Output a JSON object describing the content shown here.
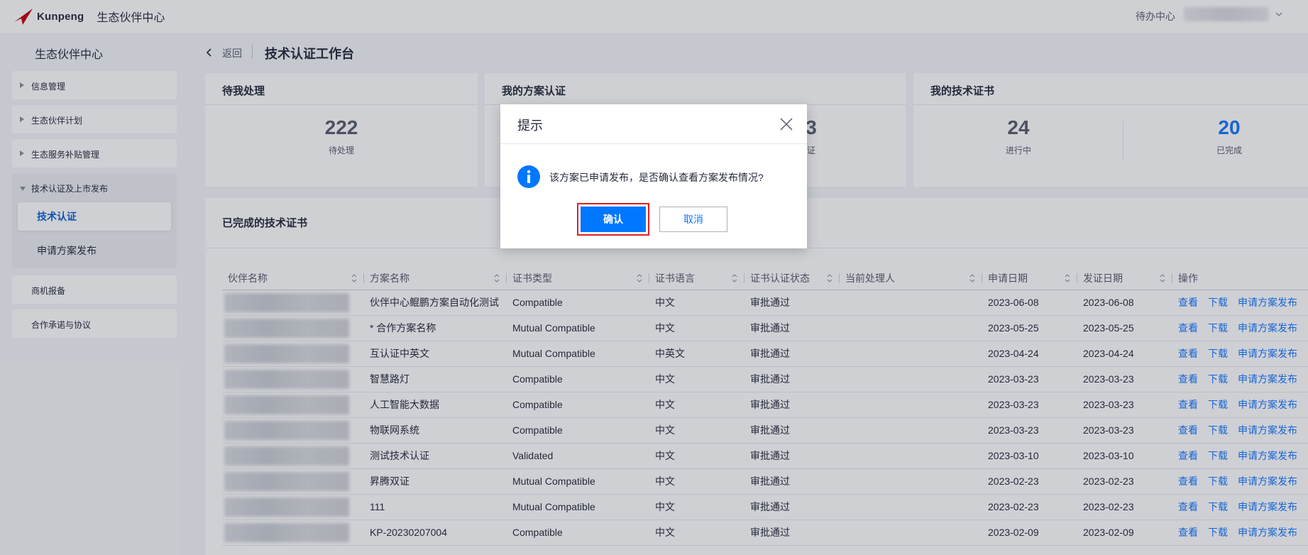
{
  "topbar": {
    "brand": "Kunpeng",
    "app_title": "生态伙伴中心",
    "todo": "待办中心"
  },
  "sidebar": {
    "title": "生态伙伴中心",
    "groups": [
      {
        "label": "信息管理"
      },
      {
        "label": "生态伙伴计划"
      },
      {
        "label": "生态服务补贴管理"
      },
      {
        "label": "技术认证及上市发布",
        "children": [
          {
            "label": "技术认证",
            "active": true
          },
          {
            "label": "申请方案发布"
          }
        ]
      },
      {
        "label": "商机报备"
      },
      {
        "label": "合作承诺与协议"
      }
    ]
  },
  "header": {
    "back": "返回",
    "title": "技术认证工作台"
  },
  "cards": {
    "pending": {
      "title": "待我处理",
      "value": "222",
      "label": "待处理"
    },
    "solution": {
      "title": "我的方案认证",
      "value_partial": "3",
      "label_partial": "证"
    },
    "certs": {
      "title": "我的技术证书",
      "in_progress_value": "24",
      "in_progress_label": "进行中",
      "done_value": "20",
      "done_label": "已完成"
    }
  },
  "table": {
    "title": "已完成的技术证书",
    "headers": [
      "伙伴名称",
      "方案名称",
      "证书类型",
      "证书语言",
      "证书认证状态",
      "当前处理人",
      "申请日期",
      "发证日期",
      "操作"
    ],
    "actions": {
      "view": "查看",
      "download": "下载",
      "publish": "申请方案发布"
    },
    "rows": [
      {
        "solution": "伙伴中心鲲鹏方案自动化测试",
        "type": "Compatible",
        "lang": "中文",
        "status": "审批通过",
        "handler": "",
        "apply": "2023-06-08",
        "issue": "2023-06-08"
      },
      {
        "solution": "* 合作方案名称",
        "type": "Mutual Compatible",
        "lang": "中文",
        "status": "审批通过",
        "handler": "",
        "apply": "2023-05-25",
        "issue": "2023-05-25"
      },
      {
        "solution": "互认证中英文",
        "type": "Mutual Compatible",
        "lang": "中英文",
        "status": "审批通过",
        "handler": "",
        "apply": "2023-04-24",
        "issue": "2023-04-24"
      },
      {
        "solution": "智慧路灯",
        "type": "Compatible",
        "lang": "中文",
        "status": "审批通过",
        "handler": "",
        "apply": "2023-03-23",
        "issue": "2023-03-23"
      },
      {
        "solution": "人工智能大数据",
        "type": "Compatible",
        "lang": "中文",
        "status": "审批通过",
        "handler": "",
        "apply": "2023-03-23",
        "issue": "2023-03-23"
      },
      {
        "solution": "物联网系统",
        "type": "Compatible",
        "lang": "中文",
        "status": "审批通过",
        "handler": "",
        "apply": "2023-03-23",
        "issue": "2023-03-23"
      },
      {
        "solution": "测试技术认证",
        "type": "Validated",
        "lang": "中文",
        "status": "审批通过",
        "handler": "",
        "apply": "2023-03-10",
        "issue": "2023-03-10"
      },
      {
        "solution": "昇腾双证",
        "type": "Mutual Compatible",
        "lang": "中文",
        "status": "审批通过",
        "handler": "",
        "apply": "2023-02-23",
        "issue": "2023-02-23"
      },
      {
        "solution": "111",
        "type": "Mutual Compatible",
        "lang": "中文",
        "status": "审批通过",
        "handler": "",
        "apply": "2023-02-23",
        "issue": "2023-02-23"
      },
      {
        "solution": "KP-20230207004",
        "type": "Compatible",
        "lang": "中文",
        "status": "审批通过",
        "handler": "",
        "apply": "2023-02-09",
        "issue": "2023-02-09"
      }
    ]
  },
  "dialog": {
    "title": "提示",
    "message": "该方案已申请发布，是否确认查看方案发布情况?",
    "confirm": "确认",
    "cancel": "取消"
  },
  "colors": {
    "accent": "#1476ff",
    "primary_button": "#0077ff",
    "highlight_outline": "#e02020"
  }
}
